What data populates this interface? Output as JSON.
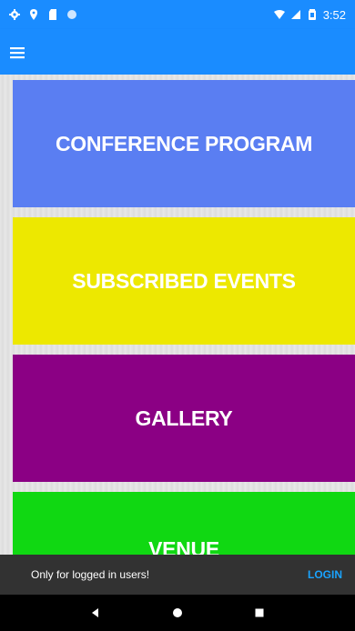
{
  "status_bar": {
    "time": "3:52",
    "left_icons": [
      "settings-icon",
      "location-icon",
      "sd-card-icon",
      "circle-icon"
    ],
    "right_icons": [
      "wifi-icon",
      "signal-icon",
      "battery-icon"
    ]
  },
  "app_bar": {
    "menu_icon": "hamburger-menu-icon"
  },
  "tiles": [
    {
      "label": "CONFERENCE PROGRAM",
      "color": "#5a7ef2"
    },
    {
      "label": "SUBSCRIBED EVENTS",
      "color": "#ede800"
    },
    {
      "label": "GALLERY",
      "color": "#8b0084"
    },
    {
      "label": "VENUE",
      "color": "#10d812"
    }
  ],
  "snackbar": {
    "message": "Only for logged in users!",
    "action": "LOGIN"
  },
  "nav_bar": {
    "buttons": [
      "back-icon",
      "home-icon",
      "recents-icon"
    ]
  },
  "colors": {
    "primary": "#1a8cff",
    "snackbar_bg": "#323232",
    "snackbar_action": "#1aa3ff"
  }
}
